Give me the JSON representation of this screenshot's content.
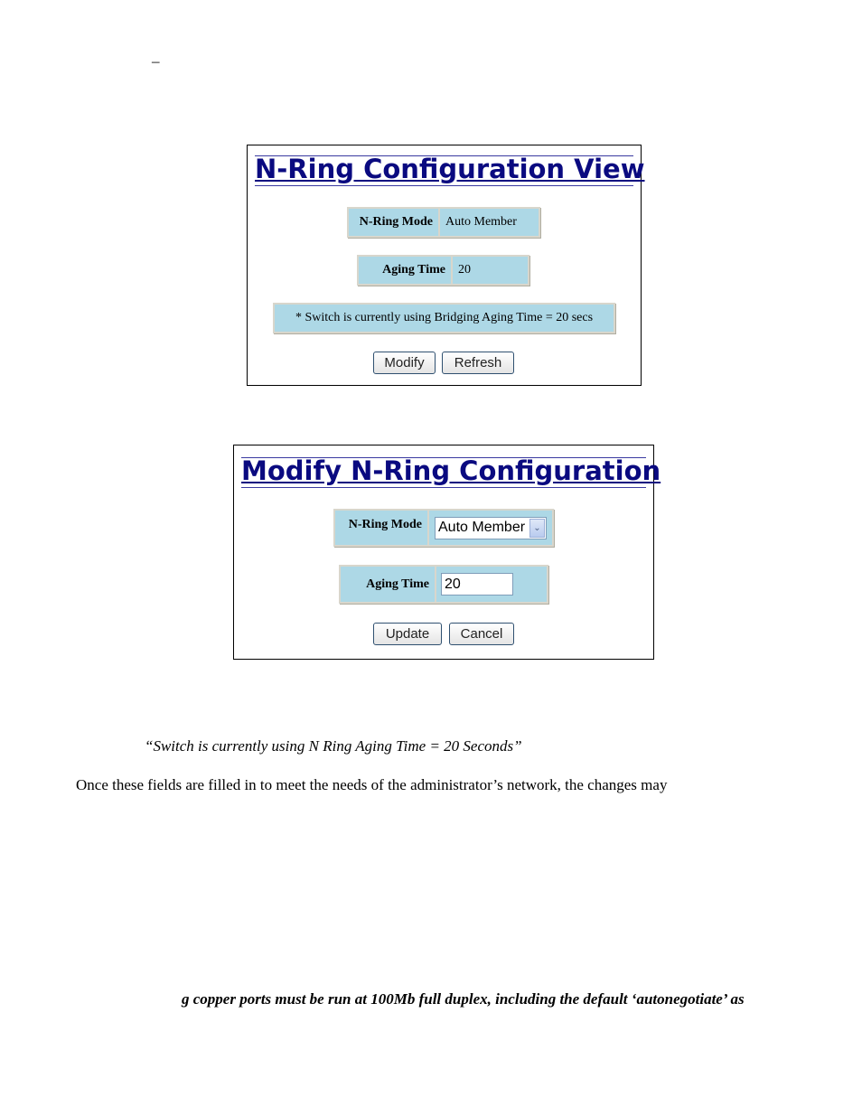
{
  "page": {
    "dash": "–",
    "caption_quote": "“Switch is currently using N Ring Aging Time = 20 Seconds”",
    "paragraph": "Once these fields are filled in to meet the needs of the administrator’s network, the changes may",
    "note_bold": "g copper ports must be run at 100Mb full duplex, including the default ‘autonegotiate’ as"
  },
  "view_panel": {
    "title": "N-Ring Configuration View",
    "mode_label": "N-Ring Mode",
    "mode_value": "Auto Member",
    "aging_label": "Aging Time",
    "aging_value": "20",
    "status_note": "* Switch is currently using Bridging Aging Time = 20 secs",
    "modify_label": "Modify",
    "refresh_label": "Refresh"
  },
  "modify_panel": {
    "title": "Modify N-Ring Configuration",
    "mode_label": "N-Ring Mode",
    "mode_selected": "Auto Member",
    "aging_label": "Aging Time",
    "aging_value": "20",
    "update_label": "Update",
    "cancel_label": "Cancel"
  },
  "colors": {
    "title": "#0a0a80",
    "table_bg": "#add8e6"
  }
}
